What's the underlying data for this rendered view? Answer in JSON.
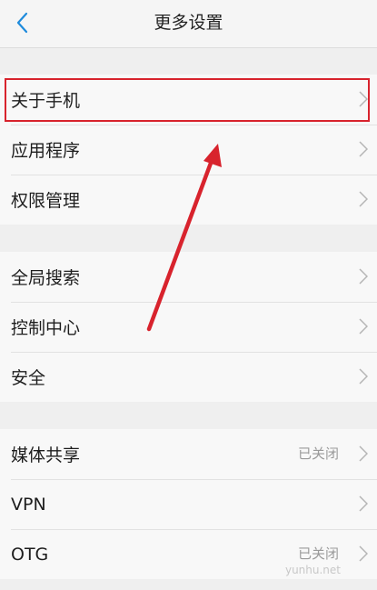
{
  "header": {
    "title": "更多设置"
  },
  "sections": [
    {
      "items": [
        {
          "label": "关于手机"
        },
        {
          "label": "应用程序"
        },
        {
          "label": "权限管理"
        }
      ]
    },
    {
      "items": [
        {
          "label": "全局搜索"
        },
        {
          "label": "控制中心"
        },
        {
          "label": "安全"
        }
      ]
    },
    {
      "items": [
        {
          "label": "媒体共享",
          "value": "已关闭"
        },
        {
          "label": "VPN"
        },
        {
          "label": "OTG",
          "value": "已关闭"
        }
      ]
    }
  ],
  "colors": {
    "accent_back": "#1e8bdc",
    "annotation_red": "#d8232d"
  },
  "watermark": "yunhu.net"
}
